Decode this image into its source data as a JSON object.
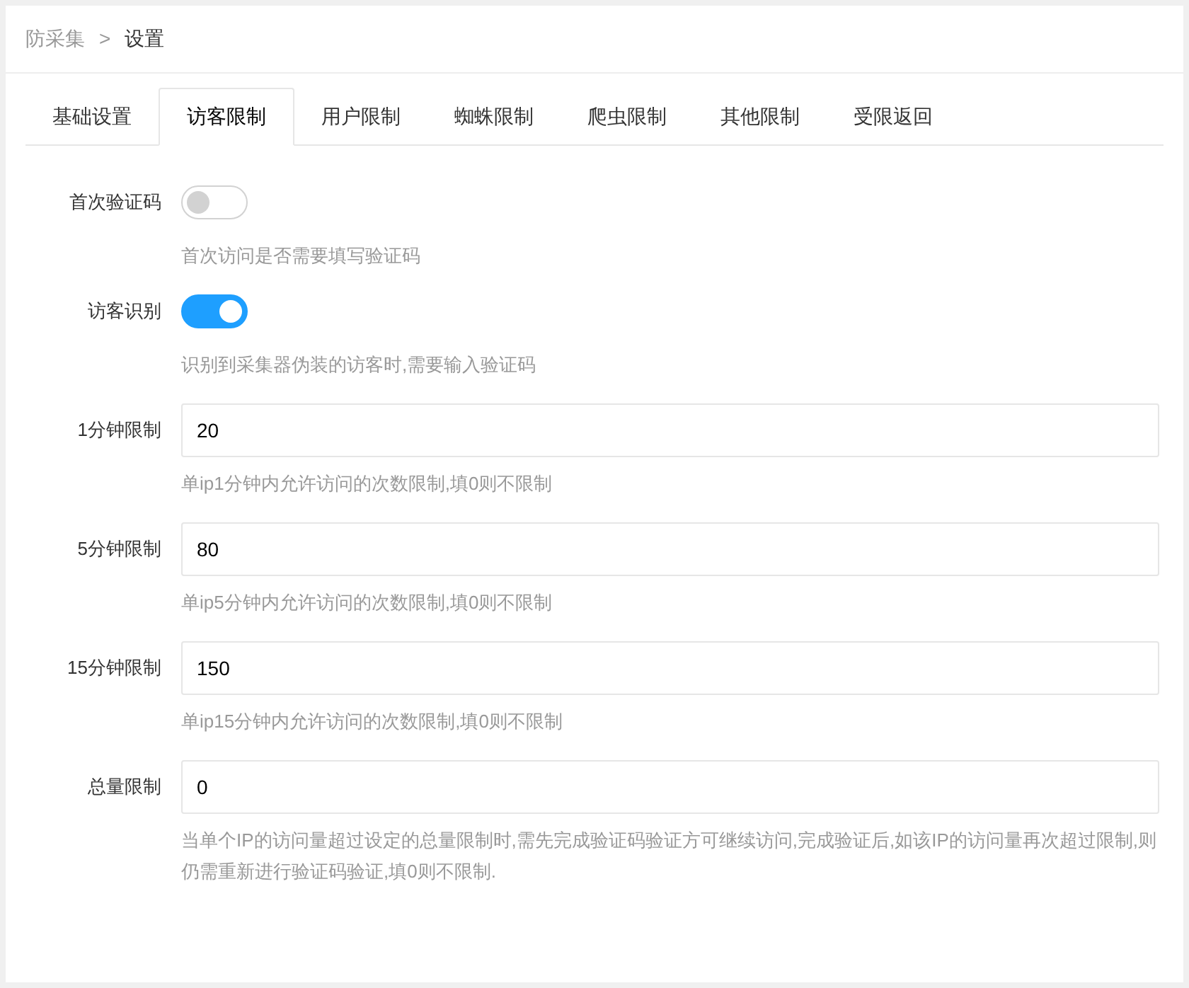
{
  "breadcrumb": [
    {
      "label": "防采集",
      "current": false
    },
    {
      "label": "设置",
      "current": true
    }
  ],
  "breadcrumb_separator": ">",
  "tabs": [
    {
      "label": "基础设置",
      "selected": false
    },
    {
      "label": "访客限制",
      "selected": true
    },
    {
      "label": "用户限制",
      "selected": false
    },
    {
      "label": "蜘蛛限制",
      "selected": false
    },
    {
      "label": "爬虫限制",
      "selected": false
    },
    {
      "label": "其他限制",
      "selected": false
    },
    {
      "label": "受限返回",
      "selected": false
    }
  ],
  "fields": [
    {
      "kind": "switch",
      "label": "首次验证码",
      "on": false,
      "help": "首次访问是否需要填写验证码"
    },
    {
      "kind": "switch",
      "label": "访客识别",
      "on": true,
      "help": "识别到采集器伪装的访客时,需要输入验证码"
    },
    {
      "kind": "input",
      "label": "1分钟限制",
      "value": "20",
      "help": "单ip1分钟内允许访问的次数限制,填0则不限制"
    },
    {
      "kind": "input",
      "label": "5分钟限制",
      "value": "80",
      "help": "单ip5分钟内允许访问的次数限制,填0则不限制"
    },
    {
      "kind": "input",
      "label": "15分钟限制",
      "value": "150",
      "help": "单ip15分钟内允许访问的次数限制,填0则不限制"
    },
    {
      "kind": "input",
      "label": "总量限制",
      "value": "0",
      "help": "当单个IP的访问量超过设定的总量限制时,需先完成验证码验证方可继续访问,完成验证后,如该IP的访问量再次超过限制,则仍需重新进行验证码验证,填0则不限制."
    }
  ]
}
